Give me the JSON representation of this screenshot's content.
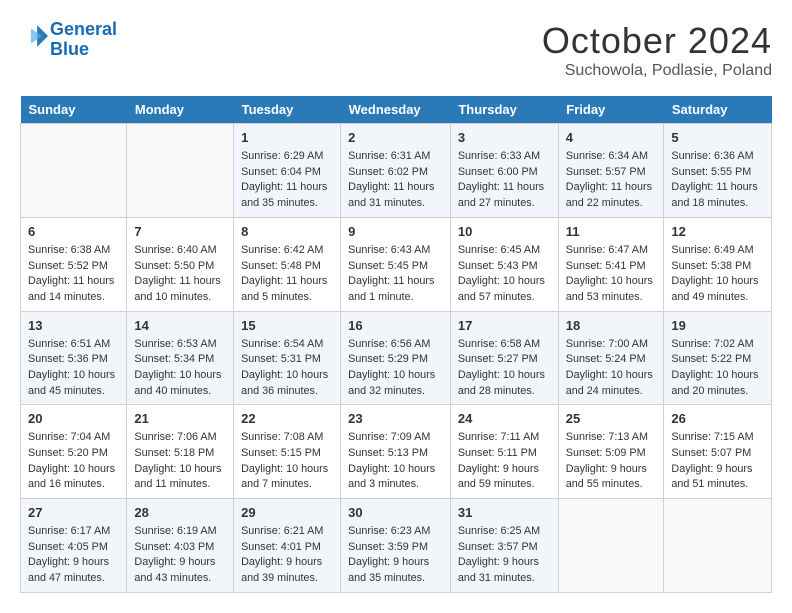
{
  "logo": {
    "line1": "General",
    "line2": "Blue"
  },
  "title": "October 2024",
  "location": "Suchowola, Podlasie, Poland",
  "days_of_week": [
    "Sunday",
    "Monday",
    "Tuesday",
    "Wednesday",
    "Thursday",
    "Friday",
    "Saturday"
  ],
  "weeks": [
    [
      {
        "day": "",
        "sunrise": "",
        "sunset": "",
        "daylight": ""
      },
      {
        "day": "",
        "sunrise": "",
        "sunset": "",
        "daylight": ""
      },
      {
        "day": "1",
        "sunrise": "Sunrise: 6:29 AM",
        "sunset": "Sunset: 6:04 PM",
        "daylight": "Daylight: 11 hours and 35 minutes."
      },
      {
        "day": "2",
        "sunrise": "Sunrise: 6:31 AM",
        "sunset": "Sunset: 6:02 PM",
        "daylight": "Daylight: 11 hours and 31 minutes."
      },
      {
        "day": "3",
        "sunrise": "Sunrise: 6:33 AM",
        "sunset": "Sunset: 6:00 PM",
        "daylight": "Daylight: 11 hours and 27 minutes."
      },
      {
        "day": "4",
        "sunrise": "Sunrise: 6:34 AM",
        "sunset": "Sunset: 5:57 PM",
        "daylight": "Daylight: 11 hours and 22 minutes."
      },
      {
        "day": "5",
        "sunrise": "Sunrise: 6:36 AM",
        "sunset": "Sunset: 5:55 PM",
        "daylight": "Daylight: 11 hours and 18 minutes."
      }
    ],
    [
      {
        "day": "6",
        "sunrise": "Sunrise: 6:38 AM",
        "sunset": "Sunset: 5:52 PM",
        "daylight": "Daylight: 11 hours and 14 minutes."
      },
      {
        "day": "7",
        "sunrise": "Sunrise: 6:40 AM",
        "sunset": "Sunset: 5:50 PM",
        "daylight": "Daylight: 11 hours and 10 minutes."
      },
      {
        "day": "8",
        "sunrise": "Sunrise: 6:42 AM",
        "sunset": "Sunset: 5:48 PM",
        "daylight": "Daylight: 11 hours and 5 minutes."
      },
      {
        "day": "9",
        "sunrise": "Sunrise: 6:43 AM",
        "sunset": "Sunset: 5:45 PM",
        "daylight": "Daylight: 11 hours and 1 minute."
      },
      {
        "day": "10",
        "sunrise": "Sunrise: 6:45 AM",
        "sunset": "Sunset: 5:43 PM",
        "daylight": "Daylight: 10 hours and 57 minutes."
      },
      {
        "day": "11",
        "sunrise": "Sunrise: 6:47 AM",
        "sunset": "Sunset: 5:41 PM",
        "daylight": "Daylight: 10 hours and 53 minutes."
      },
      {
        "day": "12",
        "sunrise": "Sunrise: 6:49 AM",
        "sunset": "Sunset: 5:38 PM",
        "daylight": "Daylight: 10 hours and 49 minutes."
      }
    ],
    [
      {
        "day": "13",
        "sunrise": "Sunrise: 6:51 AM",
        "sunset": "Sunset: 5:36 PM",
        "daylight": "Daylight: 10 hours and 45 minutes."
      },
      {
        "day": "14",
        "sunrise": "Sunrise: 6:53 AM",
        "sunset": "Sunset: 5:34 PM",
        "daylight": "Daylight: 10 hours and 40 minutes."
      },
      {
        "day": "15",
        "sunrise": "Sunrise: 6:54 AM",
        "sunset": "Sunset: 5:31 PM",
        "daylight": "Daylight: 10 hours and 36 minutes."
      },
      {
        "day": "16",
        "sunrise": "Sunrise: 6:56 AM",
        "sunset": "Sunset: 5:29 PM",
        "daylight": "Daylight: 10 hours and 32 minutes."
      },
      {
        "day": "17",
        "sunrise": "Sunrise: 6:58 AM",
        "sunset": "Sunset: 5:27 PM",
        "daylight": "Daylight: 10 hours and 28 minutes."
      },
      {
        "day": "18",
        "sunrise": "Sunrise: 7:00 AM",
        "sunset": "Sunset: 5:24 PM",
        "daylight": "Daylight: 10 hours and 24 minutes."
      },
      {
        "day": "19",
        "sunrise": "Sunrise: 7:02 AM",
        "sunset": "Sunset: 5:22 PM",
        "daylight": "Daylight: 10 hours and 20 minutes."
      }
    ],
    [
      {
        "day": "20",
        "sunrise": "Sunrise: 7:04 AM",
        "sunset": "Sunset: 5:20 PM",
        "daylight": "Daylight: 10 hours and 16 minutes."
      },
      {
        "day": "21",
        "sunrise": "Sunrise: 7:06 AM",
        "sunset": "Sunset: 5:18 PM",
        "daylight": "Daylight: 10 hours and 11 minutes."
      },
      {
        "day": "22",
        "sunrise": "Sunrise: 7:08 AM",
        "sunset": "Sunset: 5:15 PM",
        "daylight": "Daylight: 10 hours and 7 minutes."
      },
      {
        "day": "23",
        "sunrise": "Sunrise: 7:09 AM",
        "sunset": "Sunset: 5:13 PM",
        "daylight": "Daylight: 10 hours and 3 minutes."
      },
      {
        "day": "24",
        "sunrise": "Sunrise: 7:11 AM",
        "sunset": "Sunset: 5:11 PM",
        "daylight": "Daylight: 9 hours and 59 minutes."
      },
      {
        "day": "25",
        "sunrise": "Sunrise: 7:13 AM",
        "sunset": "Sunset: 5:09 PM",
        "daylight": "Daylight: 9 hours and 55 minutes."
      },
      {
        "day": "26",
        "sunrise": "Sunrise: 7:15 AM",
        "sunset": "Sunset: 5:07 PM",
        "daylight": "Daylight: 9 hours and 51 minutes."
      }
    ],
    [
      {
        "day": "27",
        "sunrise": "Sunrise: 6:17 AM",
        "sunset": "Sunset: 4:05 PM",
        "daylight": "Daylight: 9 hours and 47 minutes."
      },
      {
        "day": "28",
        "sunrise": "Sunrise: 6:19 AM",
        "sunset": "Sunset: 4:03 PM",
        "daylight": "Daylight: 9 hours and 43 minutes."
      },
      {
        "day": "29",
        "sunrise": "Sunrise: 6:21 AM",
        "sunset": "Sunset: 4:01 PM",
        "daylight": "Daylight: 9 hours and 39 minutes."
      },
      {
        "day": "30",
        "sunrise": "Sunrise: 6:23 AM",
        "sunset": "Sunset: 3:59 PM",
        "daylight": "Daylight: 9 hours and 35 minutes."
      },
      {
        "day": "31",
        "sunrise": "Sunrise: 6:25 AM",
        "sunset": "Sunset: 3:57 PM",
        "daylight": "Daylight: 9 hours and 31 minutes."
      },
      {
        "day": "",
        "sunrise": "",
        "sunset": "",
        "daylight": ""
      },
      {
        "day": "",
        "sunrise": "",
        "sunset": "",
        "daylight": ""
      }
    ]
  ]
}
